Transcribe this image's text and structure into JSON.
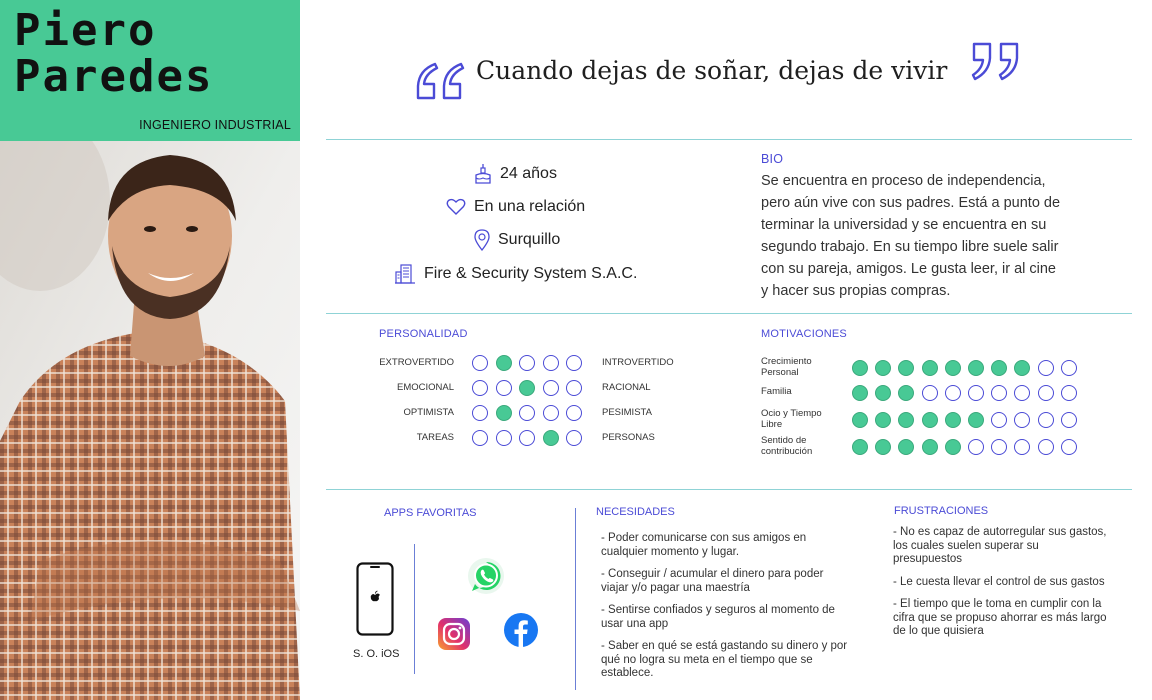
{
  "persona": {
    "first_name": "Piero",
    "last_name": "Paredes",
    "role": "INGENIERO INDUSTRIAL"
  },
  "quote": "Cuando dejas de soñar, dejas de vivir",
  "profile": {
    "age": "24 años",
    "relationship": "En una relación",
    "location": "Surquillo",
    "company": "Fire & Security System S.A.C."
  },
  "bio": {
    "title": "BIO",
    "lines": [
      "Se encuentra en proceso de independencia,",
      "pero aún vive con sus padres.  Está a punto de",
      "terminar la universidad y se encuentra en su",
      "segundo trabajo. En su tiempo libre suele salir",
      "con su pareja, amigos. Le gusta leer, ir al cine",
      "y hacer sus propias compras."
    ]
  },
  "personality": {
    "title": "PERSONALIDAD",
    "scale_points": 5,
    "rows": [
      {
        "left": "EXTROVERTIDO",
        "right": "INTROVERTIDO",
        "selected": 2
      },
      {
        "left": "EMOCIONAL",
        "right": "RACIONAL",
        "selected": 3
      },
      {
        "left": "OPTIMISTA",
        "right": "PESIMISTA",
        "selected": 2
      },
      {
        "left": "TAREAS",
        "right": "PERSONAS",
        "selected": 4
      }
    ]
  },
  "motivations": {
    "title": "MOTIVACIONES",
    "scale_points": 10,
    "rows": [
      {
        "label_lines": [
          "Crecimiento",
          "Personal"
        ],
        "level": 8
      },
      {
        "label_lines": [
          "Familia"
        ],
        "level": 3
      },
      {
        "label_lines": [
          "Ocio y Tiempo",
          "Libre"
        ],
        "level": 6
      },
      {
        "label_lines": [
          "Sentido de",
          "contribución"
        ],
        "level": 5
      }
    ]
  },
  "apps": {
    "title": "APPS FAVORITAS",
    "os_label": "S. O. iOS",
    "icons": [
      "whatsapp-icon",
      "instagram-icon",
      "facebook-icon"
    ]
  },
  "needs": {
    "title": "NECESIDADES",
    "items": [
      [
        "- Poder comunicarse con sus amigos en",
        "cualquier momento y lugar."
      ],
      [
        "- Conseguir / acumular el dinero para poder",
        "viajar y/o pagar una maestría"
      ],
      [
        "- Sentirse confiados y seguros al momento de",
        "usar una app"
      ],
      [
        "- Saber en qué se está gastando su dinero y por",
        "qué no logra su meta en el tiempo que se",
        "establece."
      ]
    ]
  },
  "frustrations": {
    "title": "FRUSTRACIONES",
    "items": [
      [
        "- No es capaz de autorregular sus gastos,",
        "los cuales suelen superar su",
        "presupuestos"
      ],
      [
        "- Le cuesta llevar el control de sus gastos"
      ],
      [
        "- El tiempo que le toma en cumplir con la",
        "cifra que se propuso ahorrar es más largo",
        "de lo que quisiera"
      ]
    ]
  },
  "colors": {
    "accent_green": "#48c995",
    "accent_blue": "#4b4bd6",
    "divider": "#8fd3d6"
  }
}
